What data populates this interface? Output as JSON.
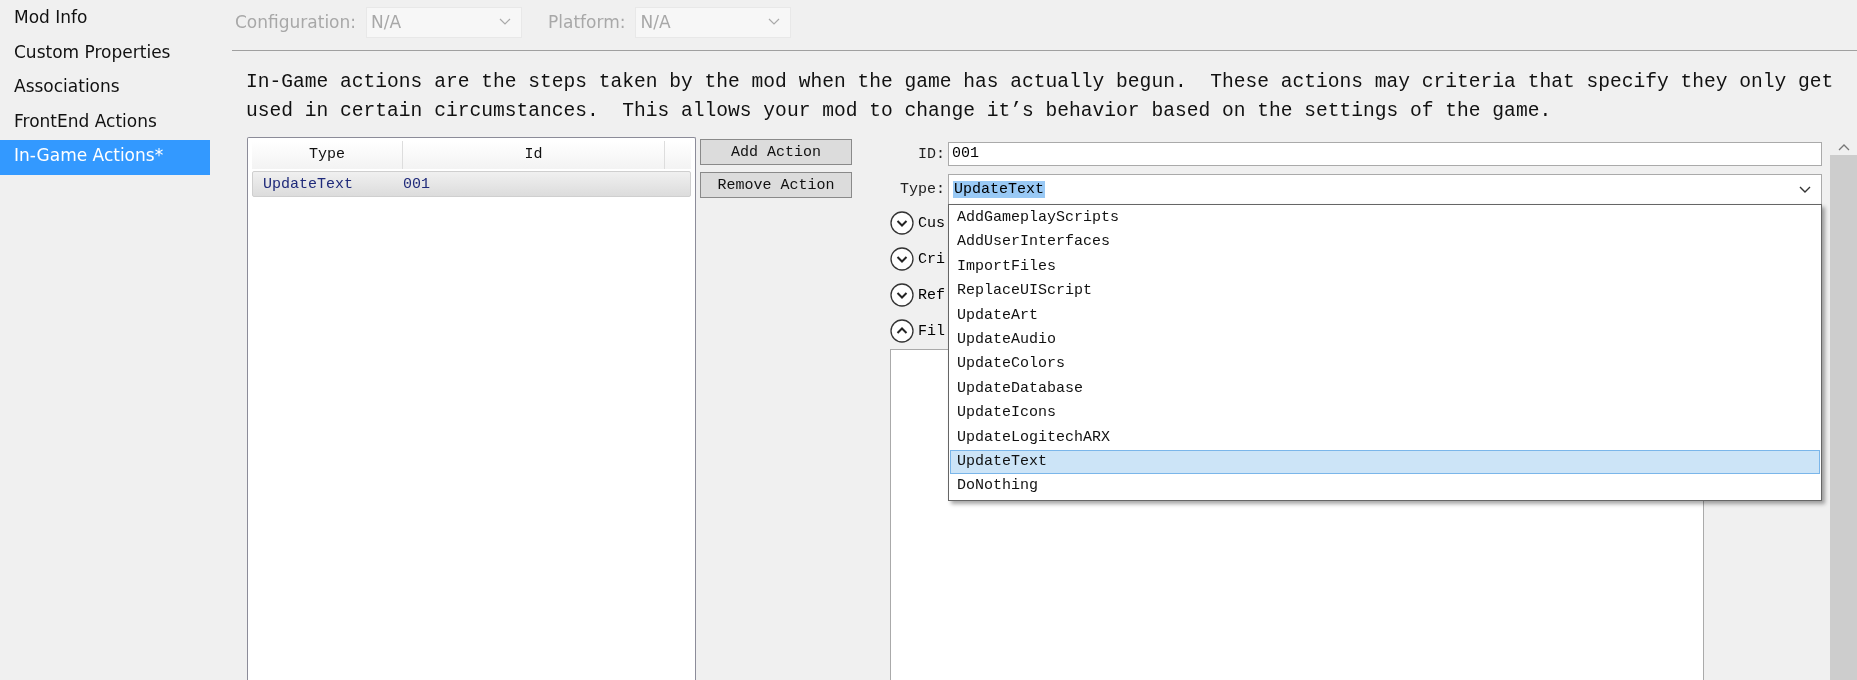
{
  "sidebar": {
    "items": [
      {
        "label": "Mod Info",
        "selected": false
      },
      {
        "label": "Custom Properties",
        "selected": false
      },
      {
        "label": "Associations",
        "selected": false
      },
      {
        "label": "FrontEnd Actions",
        "selected": false
      },
      {
        "label": "In-Game Actions*",
        "selected": true
      }
    ]
  },
  "toolbar": {
    "fields": [
      {
        "label": "Configuration:",
        "value": "N/A",
        "disabled": true
      },
      {
        "label": "Platform:",
        "value": "N/A",
        "disabled": true
      }
    ]
  },
  "description": "In-Game actions are the steps taken by the mod when the game has actually begun.  These actions may criteria that specify they only get used in certain circumstances.  This allows your mod to change it’s behavior based on the settings of the game.",
  "actions_table": {
    "columns": [
      "Type",
      "Id"
    ],
    "rows": [
      {
        "cells": [
          "UpdateText",
          "001"
        ],
        "selected": true
      }
    ]
  },
  "buttons": [
    "Add Action",
    "Remove Action"
  ],
  "details": {
    "id": {
      "label": "ID:",
      "value": "001"
    },
    "type": {
      "label": "Type:",
      "value": "UpdateText",
      "expanded": true,
      "options": [
        {
          "label": "AddGameplayScripts",
          "selected": false
        },
        {
          "label": "AddUserInterfaces",
          "selected": false
        },
        {
          "label": "ImportFiles",
          "selected": false
        },
        {
          "label": "ReplaceUIScript",
          "selected": false
        },
        {
          "label": "UpdateArt",
          "selected": false
        },
        {
          "label": "UpdateAudio",
          "selected": false
        },
        {
          "label": "UpdateColors",
          "selected": false
        },
        {
          "label": "UpdateDatabase",
          "selected": false
        },
        {
          "label": "UpdateIcons",
          "selected": false
        },
        {
          "label": "UpdateLogitechARX",
          "selected": false
        },
        {
          "label": "UpdateText",
          "selected": true
        },
        {
          "label": "DoNothing",
          "selected": false
        }
      ]
    },
    "sections": [
      {
        "label": "Cus",
        "expanded": false
      },
      {
        "label": "Cri",
        "expanded": false
      },
      {
        "label": "Ref",
        "expanded": false
      },
      {
        "label": "Fil",
        "expanded": true
      }
    ]
  }
}
